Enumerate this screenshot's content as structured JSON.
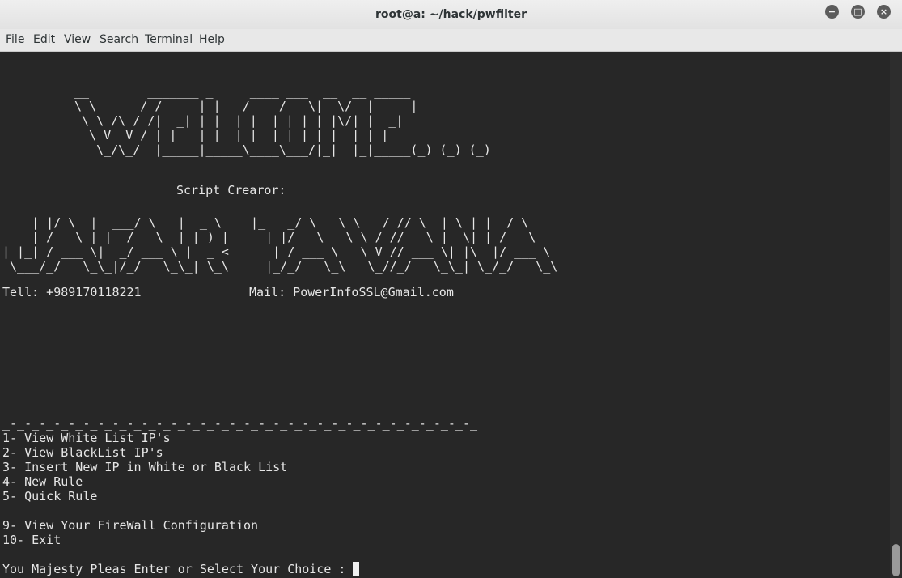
{
  "window": {
    "title": "root@a: ~/hack/pwfilter",
    "buttons": {
      "minimize": "−",
      "maximize": "□",
      "close": "×"
    }
  },
  "menubar": {
    "items": [
      "File",
      "Edit",
      "View",
      "Search",
      "Terminal",
      "Help"
    ]
  },
  "terminal": {
    "ascii_welcome": [
      "__        _______ _     ____ ___  __  __ _____",
      "\\ \\      / / ____| |   / ___/ _ \\|  \\/  | ____|",
      " \\ \\ /\\ / /|  _| | |  | |  | | | | |\\/| |  _|",
      "  \\ V  V / | |___| |__| |__| |_| | |  | | |___ _   _   _",
      "   \\_/\\_/  |_____|_____\\____\\___/|_|  |_|_____(_) (_) (_)"
    ],
    "script_creator": "Script Crearor:",
    "ascii_name": [
      "     _  _    _____ _     ____      _____ _    __     __ _    _   _    _",
      "    | |/ \\  |  ___/ \\   |  _ \\    |_   _/ \\   \\ \\   / // \\  | \\ | |  / \\",
      " _  | / _ \\ | |_ / _ \\  | |_) |     | |/ _ \\   \\ \\ / // _ \\ |  \\| | / _ \\",
      "| |_| / ___ \\|  _/ ___ \\ |  _ <      | / ___ \\   \\ V // ___ \\| |\\  |/ ___ \\",
      " \\___/_/   \\_\\_|/_/   \\_\\_| \\_\\     |_/_/   \\_\\   \\_//_/   \\_\\_| \\_/_/   \\_\\"
    ],
    "tell": "Tell: +989170118221",
    "mail": "Mail: PowerInfoSSL@Gmail.com",
    "separator": "_-_-_-_-_-_-_-_-_-_-_-_-_-_-_-_-_-_-_-_-_-_-_-_-_-_-_-_-_-_-_-_-_",
    "menu_options": [
      "1- View White List IP's",
      "2- View BlackList IP's",
      "3- Insert New IP in White or Black List",
      "4- New Rule",
      "5- Quick Rule",
      "9- View Your FireWall Configuration",
      "10- Exit"
    ],
    "prompt": "You Majesty Pleas Enter or Select Your Choice : "
  }
}
